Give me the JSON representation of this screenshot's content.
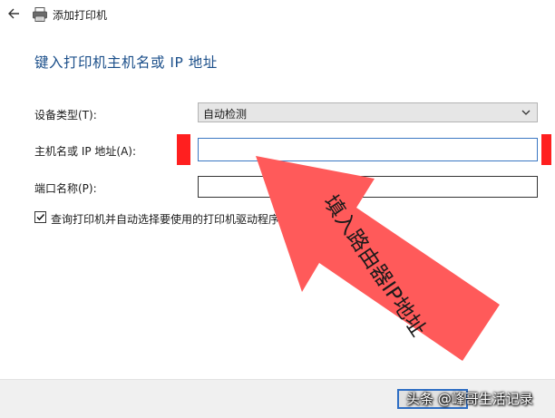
{
  "window": {
    "title": "添加打印机",
    "back_icon": "arrow-left-icon",
    "app_icon": "printer-icon"
  },
  "page": {
    "heading": "键入打印机主机名或 IP 地址"
  },
  "form": {
    "device_type": {
      "label": "设备类型(T):",
      "value": "自动检测"
    },
    "hostname": {
      "label": "主机名或 IP 地址(A):",
      "value": ""
    },
    "port_name": {
      "label": "端口名称(P):",
      "value": ""
    },
    "query_printer": {
      "label": "查询打印机并自动选择要使用的打印机驱动程序(Q)",
      "checked": true
    }
  },
  "annotation": {
    "text": "填入路由器IP地址",
    "color": "#ff5a5a",
    "highlight_color": "#ff1f1f"
  },
  "watermark": {
    "text": "头条 @峰哥生活记录"
  },
  "colors": {
    "heading": "#1b4f8a",
    "focus_border": "#3b78c3"
  }
}
